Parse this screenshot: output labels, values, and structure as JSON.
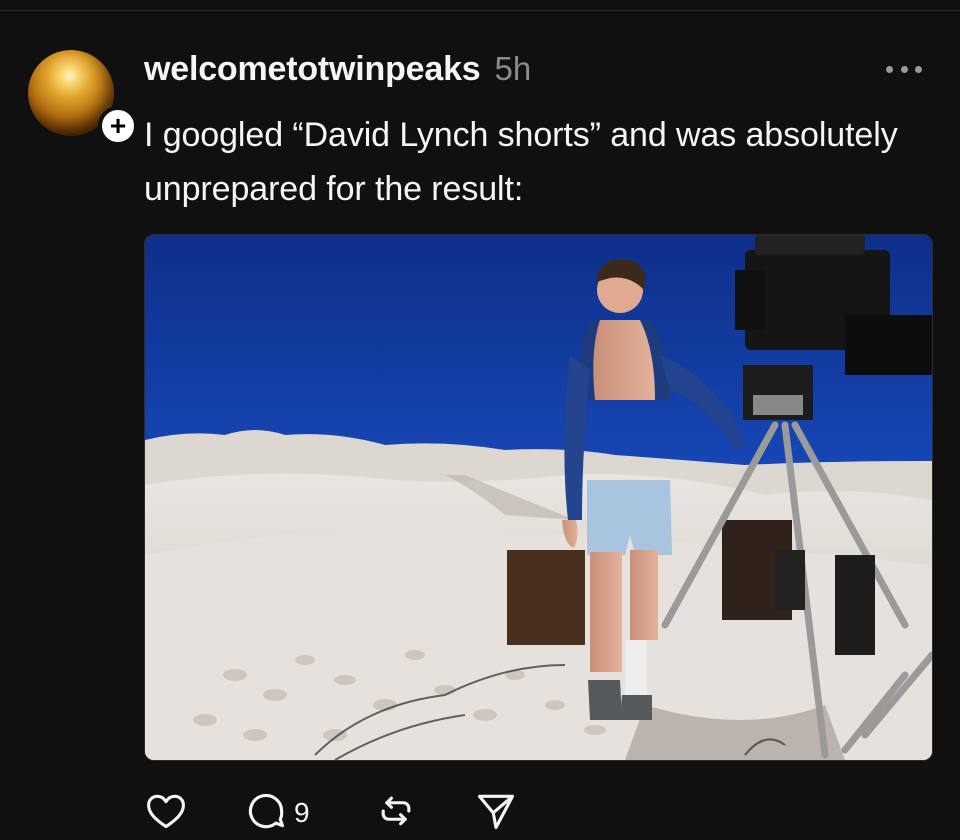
{
  "post": {
    "username": "welcometotwinpeaks",
    "timestamp": "5h",
    "text": "I googled “David Lynch shorts” and was absolutely unprepared for the result:",
    "follow_badge": "+",
    "image_alt": "Man in blue shorts and open jacket standing beside a film camera on a tripod in desert sand dunes under a deep blue sky",
    "actions": {
      "like_icon": "heart-icon",
      "reply_icon": "comment-icon",
      "reply_count": "9",
      "repost_icon": "repost-icon",
      "share_icon": "send-icon"
    },
    "more_icon": "more-options-icon"
  },
  "colors": {
    "background": "#101010",
    "text_primary": "#f3f5f7",
    "text_secondary": "#8a8a8a"
  }
}
